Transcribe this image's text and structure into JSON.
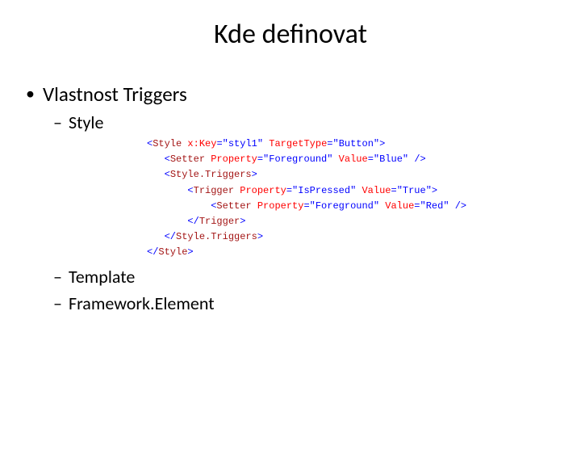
{
  "title": "Kde definovat",
  "bullet": "Vlastnost Triggers",
  "sub": {
    "style": "Style",
    "template": "Template",
    "frameworkElement": "Framework.Element"
  },
  "code": {
    "l1": {
      "open": "<",
      "tag": "Style",
      "a1": "x:Key",
      "v1": "styl1",
      "a2": "TargetType",
      "v2": "Button",
      "close": ">"
    },
    "l2": {
      "open": "<",
      "tag": "Setter",
      "a1": "Property",
      "v1": "Foreground",
      "a2": "Value",
      "v2": "Blue",
      "close": "/>"
    },
    "l3": {
      "open": "<",
      "tag": "Style.Triggers",
      "close": ">"
    },
    "l4": {
      "open": "<",
      "tag": "Trigger",
      "a1": "Property",
      "v1": "IsPressed",
      "a2": "Value",
      "v2": "True",
      "close": ">"
    },
    "l5": {
      "open": "<",
      "tag": "Setter",
      "a1": "Property",
      "v1": "Foreground",
      "a2": "Value",
      "v2": "Red",
      "close": "/>"
    },
    "l6": {
      "open": "</",
      "tag": "Trigger",
      "close": ">"
    },
    "l7": {
      "open": "</",
      "tag": "Style.Triggers",
      "close": ">"
    },
    "l8": {
      "open": "</",
      "tag": "Style",
      "close": ">"
    }
  }
}
